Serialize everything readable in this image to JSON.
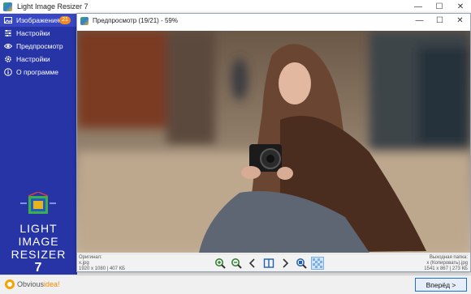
{
  "app": {
    "title": "Light Image Resizer 7"
  },
  "sidebar": {
    "items": [
      {
        "label": "Изображения",
        "icon": "images-icon",
        "badge": "21",
        "active": true
      },
      {
        "label": "Настройки",
        "icon": "sliders-icon"
      },
      {
        "label": "Предпросмотр",
        "icon": "eye-icon"
      },
      {
        "label": "Настройки",
        "icon": "gear-icon"
      },
      {
        "label": "О программе",
        "icon": "info-icon"
      }
    ],
    "logo": {
      "line1": "LIGHT",
      "line2": "IMAGE",
      "line3": "RESIZER",
      "version": "7"
    }
  },
  "preview": {
    "title": "Предпросмотр (19/21) - 59%",
    "original": {
      "label": "Оригинал:",
      "name": "x.jpg",
      "dims": "1920 x 1080",
      "size": "407 КБ"
    },
    "output": {
      "label": "Выходная папка:",
      "name": "x (Копировать).jpg",
      "dims": "1541 x 867",
      "size": "273 КБ"
    },
    "tools": [
      "zoom-in-icon",
      "zoom-out-icon",
      "prev-icon",
      "compare-icon",
      "next-icon",
      "zoom-fit-icon",
      "checker-icon"
    ]
  },
  "footer": {
    "brand_a": "Obvious",
    "brand_b": "idea!",
    "next_button": "Вперёд >"
  },
  "colors": {
    "sidebar": "#2734a6",
    "sidebar_active": "#3848c4",
    "badge": "#f08a24",
    "accent": "#1e6fd0"
  }
}
